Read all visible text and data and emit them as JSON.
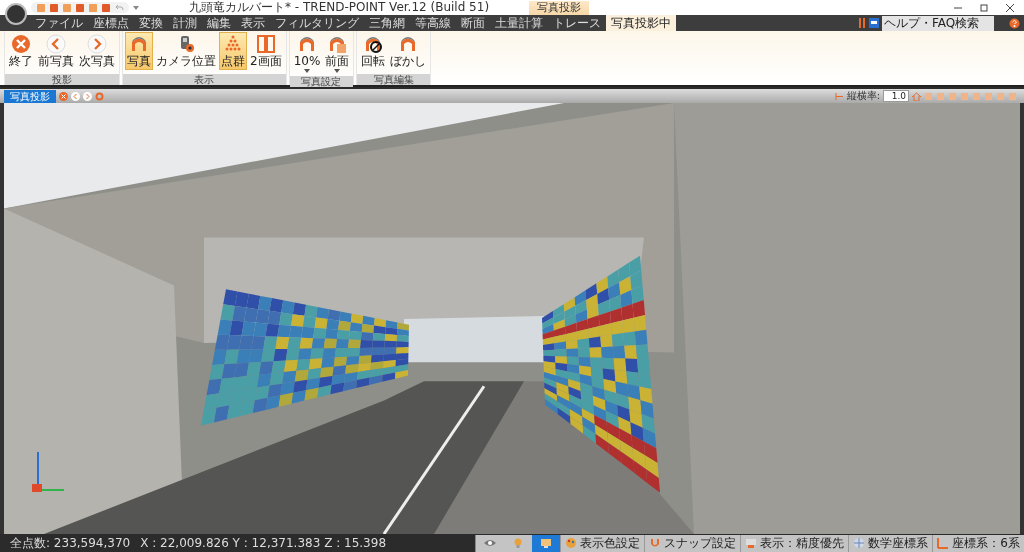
{
  "window": {
    "title": "九頭竜カルバート* - TREND-POINT Ver.12 (Build 51)",
    "context_tab": "写真投影"
  },
  "menu": [
    {
      "label": "ファイル",
      "selected": false
    },
    {
      "label": "座標点",
      "selected": false
    },
    {
      "label": "変換",
      "selected": false
    },
    {
      "label": "計測",
      "selected": false
    },
    {
      "label": "編集",
      "selected": false
    },
    {
      "label": "表示",
      "selected": false
    },
    {
      "label": "フィルタリング",
      "selected": false
    },
    {
      "label": "三角網",
      "selected": false
    },
    {
      "label": "等高線",
      "selected": false
    },
    {
      "label": "断面",
      "selected": false
    },
    {
      "label": "土量計算",
      "selected": false
    },
    {
      "label": "トレース",
      "selected": false
    },
    {
      "label": "写真投影中",
      "selected": true
    }
  ],
  "help_search": {
    "placeholder": "ヘルプ・FAQ検索"
  },
  "ribbon_groups": [
    {
      "title": "投影",
      "buttons": [
        {
          "label": "終了",
          "kind": "close",
          "selected": false,
          "dropdown": false
        },
        {
          "label": "前写真",
          "kind": "prev",
          "selected": false,
          "dropdown": false
        },
        {
          "label": "次写真",
          "kind": "next",
          "selected": false,
          "dropdown": false
        }
      ]
    },
    {
      "title": "表示",
      "buttons": [
        {
          "label": "写真",
          "kind": "photo",
          "selected": true,
          "dropdown": false
        },
        {
          "label": "カメラ位置",
          "kind": "camera",
          "selected": false,
          "dropdown": false
        },
        {
          "label": "点群",
          "kind": "points",
          "selected": true,
          "dropdown": false
        },
        {
          "label": "2画面",
          "kind": "split",
          "selected": false,
          "dropdown": false
        }
      ]
    },
    {
      "title": "写真設定",
      "buttons": [
        {
          "label": "10%",
          "kind": "photo",
          "selected": false,
          "dropdown": true
        },
        {
          "label": "前面",
          "kind": "front",
          "selected": false,
          "dropdown": true
        }
      ]
    },
    {
      "title": "写真編集",
      "buttons": [
        {
          "label": "回転",
          "kind": "rotate",
          "selected": false,
          "dropdown": false
        },
        {
          "label": "ぼかし",
          "kind": "photo",
          "selected": false,
          "dropdown": false
        }
      ]
    }
  ],
  "view_tabs": [
    {
      "label": "写真投影",
      "selected": true
    }
  ],
  "view_toolbar": {
    "aspect_label": "縦横率:",
    "aspect_value": "1.0"
  },
  "status_bar": {
    "point_count": "全点数: 233,594,370",
    "coords": "X : 22,009.826  Y : 12,371.383  Z : 15.398",
    "toggles": [
      {
        "kind": "eye",
        "selected": false
      },
      {
        "kind": "bulb",
        "selected": false
      },
      {
        "kind": "monitor",
        "selected": true
      }
    ],
    "items": [
      {
        "label": "表示色設定",
        "kind": "palette"
      },
      {
        "label": "スナップ設定",
        "kind": "magnet"
      },
      {
        "label": "表示：精度優先",
        "kind": "display"
      },
      {
        "label": "数学座標系",
        "kind": "globe"
      },
      {
        "label": "座標系：6系",
        "kind": "axes"
      }
    ]
  }
}
